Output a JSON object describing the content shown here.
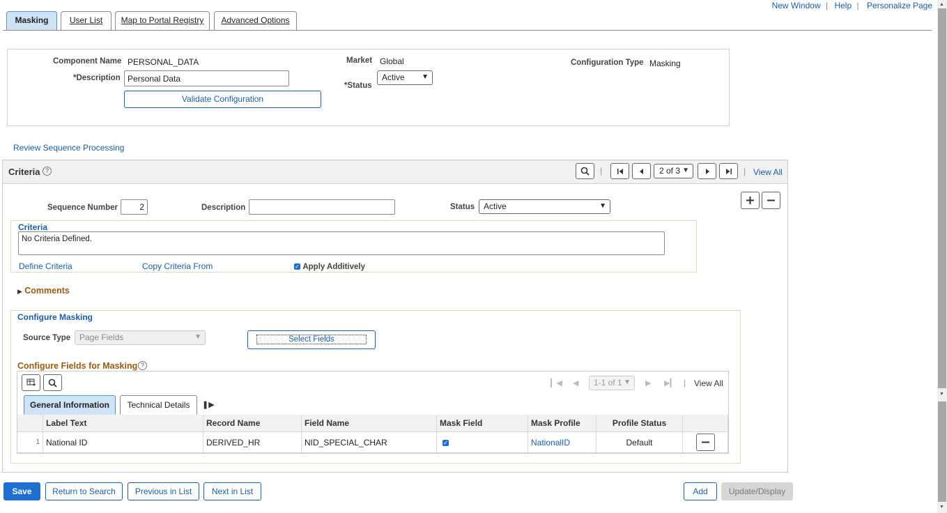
{
  "top_links": {
    "new_window": "New Window",
    "help": "Help",
    "personalize": "Personalize Page",
    "sep": "|"
  },
  "tabs": [
    {
      "label": "Masking",
      "active": true
    },
    {
      "label": "User List",
      "active": false
    },
    {
      "label": "Map to Portal Registry",
      "active": false
    },
    {
      "label": "Advanced Options",
      "active": false
    }
  ],
  "header": {
    "component_name_label": "Component Name",
    "component_name_value": "PERSONAL_DATA",
    "description_label": "*Description",
    "description_value": "Personal Data",
    "validate_button": "Validate Configuration",
    "market_label": "Market",
    "market_value": "Global",
    "status_label": "*Status",
    "status_value": "Active",
    "config_type_label": "Configuration Type",
    "config_type_value": "Masking"
  },
  "review_link": "Review Sequence Processing",
  "criteria_panel": {
    "title": "Criteria",
    "pager_value": "2 of 3",
    "view_all": "View All",
    "sep": "|",
    "sequence_label": "Sequence Number",
    "sequence_value": "2",
    "description_label": "Description",
    "description_value": "",
    "status_label": "Status",
    "status_value": "Active",
    "criteria_title": "Criteria",
    "criteria_text": "No Criteria Defined.",
    "define_criteria": "Define Criteria",
    "copy_criteria": "Copy Criteria From",
    "apply_additively": "Apply Additively",
    "comments": "Comments"
  },
  "configure_masking": {
    "title": "Configure Masking",
    "source_type_label": "Source Type",
    "source_type_value": "Page Fields",
    "select_fields_button": "Select Fields",
    "fields_title": "Configure Fields for Masking",
    "pager_value": "1-1 of 1",
    "view_all": "View All",
    "sep": "|",
    "grid_tabs": [
      "General Information",
      "Technical Details"
    ],
    "columns": [
      "Label Text",
      "Record Name",
      "Field Name",
      "Mask Field",
      "Mask Profile",
      "Profile Status"
    ],
    "rows": [
      {
        "num": "1",
        "label_text": "National ID",
        "record_name": "DERIVED_HR",
        "field_name": "NID_SPECIAL_CHAR",
        "mask_field": true,
        "mask_profile": "NationalID",
        "profile_status": "Default"
      }
    ]
  },
  "footer": {
    "save": "Save",
    "return_to_search": "Return to Search",
    "previous_in_list": "Previous in List",
    "next_in_list": "Next in List",
    "add": "Add",
    "update_display": "Update/Display"
  }
}
